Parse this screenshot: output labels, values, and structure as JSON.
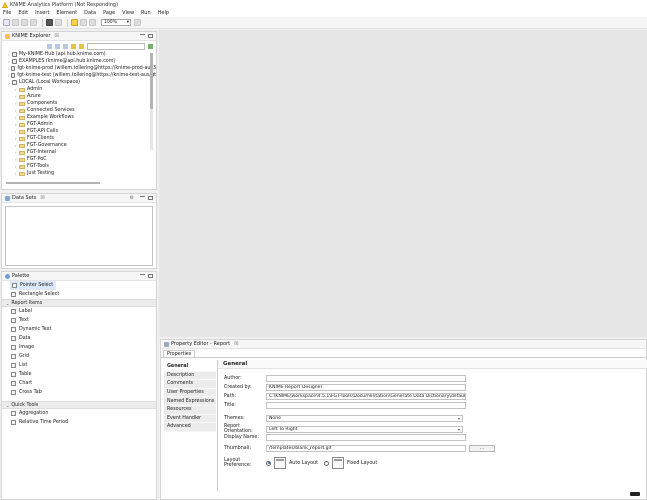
{
  "window": {
    "title": "KNIME Analytics Platform (Not Responding)"
  },
  "menu": [
    "File",
    "Edit",
    "Insert",
    "Element",
    "Data",
    "Page",
    "View",
    "Run",
    "Help"
  ],
  "toolbar": {
    "zoom": "100%"
  },
  "explorer": {
    "title": "KNIME Explorer",
    "mounts": [
      "My-KNIME-Hub (api.hub.knime.com)",
      "EXAMPLES (knime@api.hub.knime.com)",
      "fgt-knime-prod (willem.tollering@https://knime-prod-aus3",
      "fgt-knime-test (willem.tollering@https://knime-test-aus/gt",
      "LOCAL (Local Workspace)"
    ],
    "folders": [
      "Admin",
      "Azure",
      "Components",
      "Connected Services",
      "Example Workflows",
      "FGT-Admin",
      "FGT-API Calls",
      "FGT-Clients",
      "FGT-Governance",
      "FGT-Internal",
      "FGT-PoC",
      "FGT-Tools",
      "Just Testing"
    ]
  },
  "dataset": {
    "title": "Data Sets"
  },
  "palette": {
    "title": "Palette",
    "tools": [
      "Pointer Select",
      "Rectangle Select"
    ],
    "group_report": "Report Items",
    "report_items": [
      "Label",
      "Text",
      "Dynamic Text",
      "Data",
      "Image",
      "Grid",
      "List",
      "Table",
      "Chart",
      "Cross Tab"
    ],
    "group_quick": "Quick Tools",
    "quick_items": [
      "Aggregation",
      "Relative Time Period"
    ]
  },
  "property_editor": {
    "title": "Property Editor - Report",
    "tab": "Properties",
    "side": [
      "General",
      "Description",
      "Comments",
      "User Properties",
      "Named Expressions",
      "Resources",
      "Event Handler",
      "Advanced"
    ],
    "heading": "General",
    "author_label": "Author:",
    "author_value": "",
    "created_label": "Created by:",
    "created_value": "KNIME Report Designer",
    "path_label": "Path:",
    "path_value": "C:\\KNIME\\workspace\\4.5.1\\FGT-Tools\\Documentation\\Generate Data Dictionary\\default_report",
    "title_label": "Title:",
    "title_value": "",
    "themes_label": "Themes:",
    "themes_value": "None",
    "orientation_label": "Report Orientation:",
    "orientation_value": "Left To Right",
    "display_label": "Display Name:",
    "display_value": "",
    "thumb_label": "Thumbnail:",
    "thumb_value": "/templates/blank_report.gif",
    "thumb_btn": "...",
    "layout_label": "Layout Preference:",
    "layout_auto": "Auto Layout",
    "layout_fixed": "Fixed Layout"
  },
  "colors": {
    "accent": "#1c5fa8",
    "folder": "#f0d88c",
    "selection": "#dbe8f7"
  }
}
